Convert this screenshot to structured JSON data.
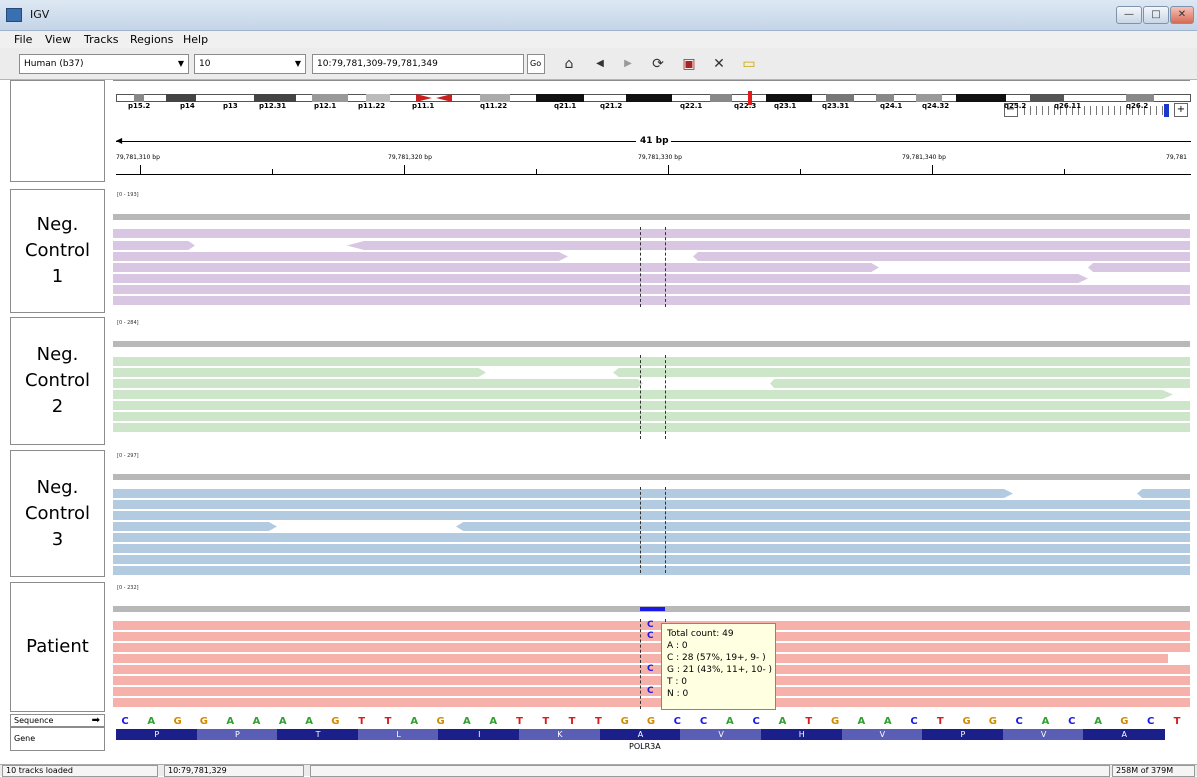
{
  "window": {
    "title": "IGV"
  },
  "menu": [
    "File",
    "View",
    "Tracks",
    "Regions",
    "Help"
  ],
  "toolbar": {
    "genome": "Human (b37)",
    "chromosome": "10",
    "locus": "10:79,781,309-79,781,349",
    "go_label": "Go"
  },
  "ideogram": {
    "bands": [
      "p15.2",
      "p14",
      "p13",
      "p12.31",
      "p12.1",
      "p11.22",
      "p11.1",
      "q11.22",
      "q21.1",
      "q21.2",
      "q22.1",
      "q22.3",
      "q23.1",
      "q23.31",
      "q24.1",
      "q24.32",
      "q25.2",
      "q26.11",
      "q26.2"
    ]
  },
  "ruler": {
    "span": "41 bp",
    "ticks": [
      "79,781,310 bp",
      "79,781,320 bp",
      "79,781,330 bp",
      "79,781,340 bp",
      "79,781"
    ]
  },
  "tracks": [
    {
      "name": "Neg.\nControl\n1",
      "range": "[0 - 193]",
      "color": "#d9c6e3"
    },
    {
      "name": "Neg.\nControl\n2",
      "range": "[0 - 284]",
      "color": "#cde5c8"
    },
    {
      "name": "Neg.\nControl\n3",
      "range": "[0 - 297]",
      "color": "#b2cbe1"
    },
    {
      "name": "Patient",
      "range": "[0 - 232]",
      "color": "#f6b1ab"
    }
  ],
  "patient_calls": [
    "C",
    "C",
    "C",
    "C"
  ],
  "tooltip": {
    "total": "Total count: 49",
    "a": "A : 0",
    "c": "C : 28 (57%, 19+, 9- )",
    "g": "G : 21 (43%, 11+, 10- )",
    "t": "T : 0",
    "n": "N : 0"
  },
  "sequence": {
    "label": "Sequence",
    "bases": "CAGGAAAAGTTAGAATTTTGGCCACATGAACTGGCACAGCT"
  },
  "gene": {
    "label": "Gene",
    "name": "POLR3A",
    "aminoacids": [
      "P",
      "P",
      "T",
      "L",
      "I",
      "K",
      "A",
      "V",
      "H",
      "V",
      "P",
      "V",
      "A"
    ]
  },
  "status": {
    "tracks": "10 tracks loaded",
    "position": "10:79,781,329",
    "memory": "258M of 379M"
  },
  "colors": {
    "A": "#2ea12e",
    "C": "#1a1ae6",
    "G": "#d18a00",
    "T": "#e01818",
    "gene_dark": "#1b1f8a",
    "gene_light": "#5a5fb5"
  }
}
